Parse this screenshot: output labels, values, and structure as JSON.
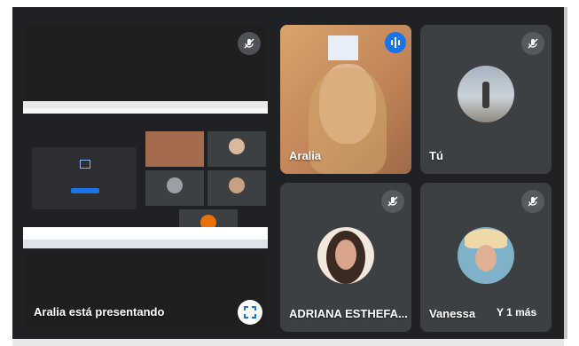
{
  "presenter_tile": {
    "label": "Aralia está presentando"
  },
  "participants": [
    {
      "name": "Aralia"
    },
    {
      "name": "Tú"
    },
    {
      "name": "ADRIANA ESTHEFA..."
    },
    {
      "name": "Vanessa"
    }
  ],
  "overflow": {
    "label": "Y 1 más"
  },
  "colors": {
    "stage_bg": "#202124",
    "tile_bg": "#3c4043",
    "mic_bubble": "#5f6368",
    "accent_blue": "#1a73e8",
    "label_text": "#ffffff"
  },
  "icons": [
    "mic-off-icon",
    "fullscreen-icon",
    "speaking-indicator-icon"
  ]
}
